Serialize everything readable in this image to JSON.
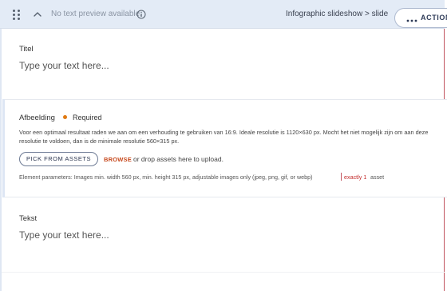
{
  "header": {
    "preview_text": "No text preview available.",
    "breadcrumb": "Infographic slideshow > slide",
    "actions_label": "ACTIONS",
    "icons": [
      "drag-handle-icon",
      "chevron-up-icon",
      "info-icon",
      "more-dots-icon"
    ]
  },
  "titel": {
    "label": "Titel",
    "placeholder": "Type your text here..."
  },
  "afbeelding": {
    "label": "Afbeelding",
    "required_label": "Required",
    "description": "Voor een optimaal resultaat raden we aan om een verhouding te gebruiken van 16:9. Ideale resolutie is 1120×630 px. Mocht het niet mogelijk zijn om aan deze resolutie te voldoen, dan is de minimale resolutie 560×315 px.",
    "pick_button": "PICK FROM ASSETS",
    "browse": "BROWSE",
    "drop_text": "or drop assets here to upload.",
    "params": "Element parameters: Images min. width 560 px, min. height 315 px, adjustable images only (jpeg, png, gif, or webp)",
    "exactly": "exactly 1",
    "exactly_tail": "asset"
  },
  "tekst": {
    "label": "Tekst",
    "placeholder": "Type your text here..."
  },
  "colors": {
    "header_bg": "#e3ebf6",
    "required_dot": "#e07a12",
    "browse": "#c74a1e",
    "exactly": "#c22c2c"
  }
}
